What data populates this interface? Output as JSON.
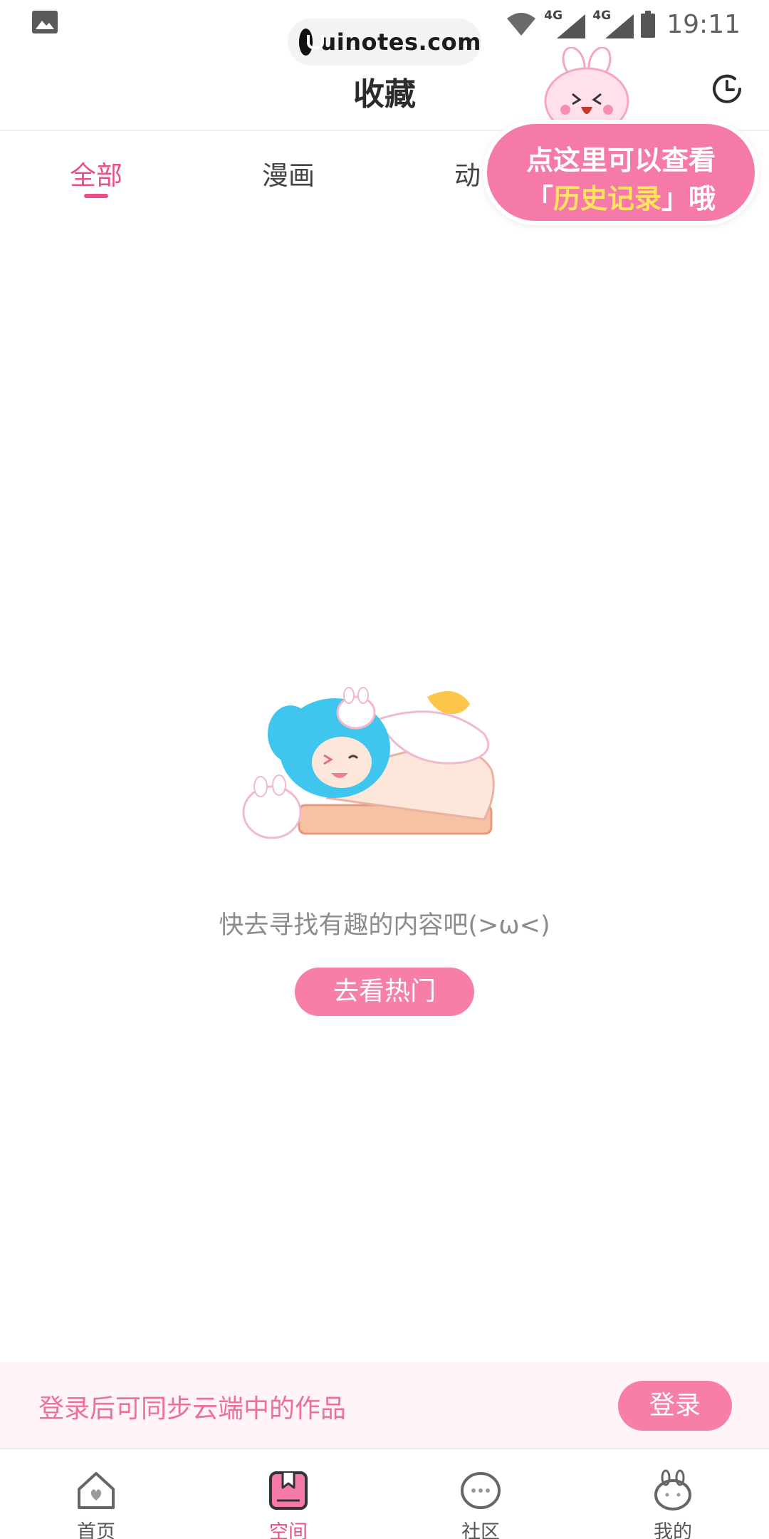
{
  "status_bar": {
    "time": "19:11",
    "network_1": "4G",
    "network_2": "4G"
  },
  "watermark": {
    "text": "uinotes.com"
  },
  "header": {
    "title": "收藏"
  },
  "tabs": [
    {
      "label": "全部",
      "active": true
    },
    {
      "label": "漫画",
      "active": false
    },
    {
      "label": "动",
      "active": false
    }
  ],
  "tooltip": {
    "line1": "点这里可以查看",
    "line2_prefix": "「",
    "line2_highlight": "历史记录",
    "line2_suffix": "」哦"
  },
  "empty_state": {
    "message": "快去寻找有趣的内容吧(>ω<)",
    "button_label": "去看热门"
  },
  "login_banner": {
    "hint": "登录后可同步云端中的作品",
    "button_label": "登录"
  },
  "bottom_nav": [
    {
      "label": "首页",
      "icon": "home-icon",
      "active": false
    },
    {
      "label": "空间",
      "icon": "space-icon",
      "active": true
    },
    {
      "label": "社区",
      "icon": "community-icon",
      "active": false
    },
    {
      "label": "我的",
      "icon": "profile-icon",
      "active": false
    }
  ],
  "colors": {
    "accent": "#ea4f8a",
    "button_pink": "#f77ea8",
    "banner_bg": "#fff4f7",
    "tooltip_bg": "#f57aaa",
    "tooltip_highlight": "#ffe45c"
  }
}
